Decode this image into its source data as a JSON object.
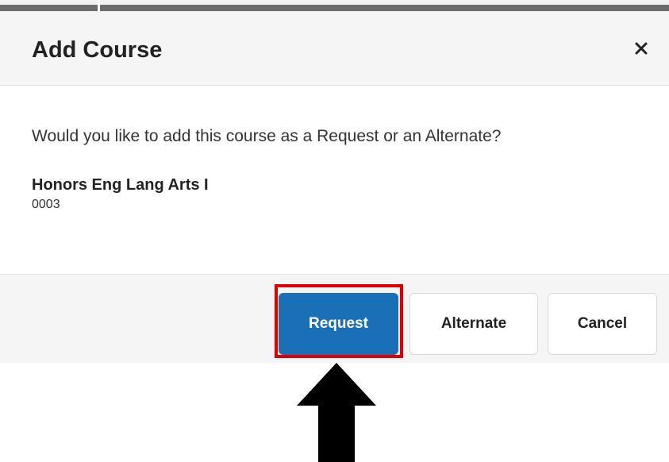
{
  "dialog": {
    "title": "Add Course",
    "close_icon": "close-icon",
    "prompt": "Would you like to add this course as a Request or an Alternate?",
    "course": {
      "name": "Honors Eng Lang Arts I",
      "code": "0003"
    },
    "buttons": {
      "request": "Request",
      "alternate": "Alternate",
      "cancel": "Cancel"
    }
  },
  "annotations": {
    "highlight_color": "#e00000",
    "arrow_icon": "up-arrow-icon",
    "arrow_color": "#000000"
  },
  "colors": {
    "primary": "#1a70b7",
    "header_bg": "#f5f5f5"
  }
}
